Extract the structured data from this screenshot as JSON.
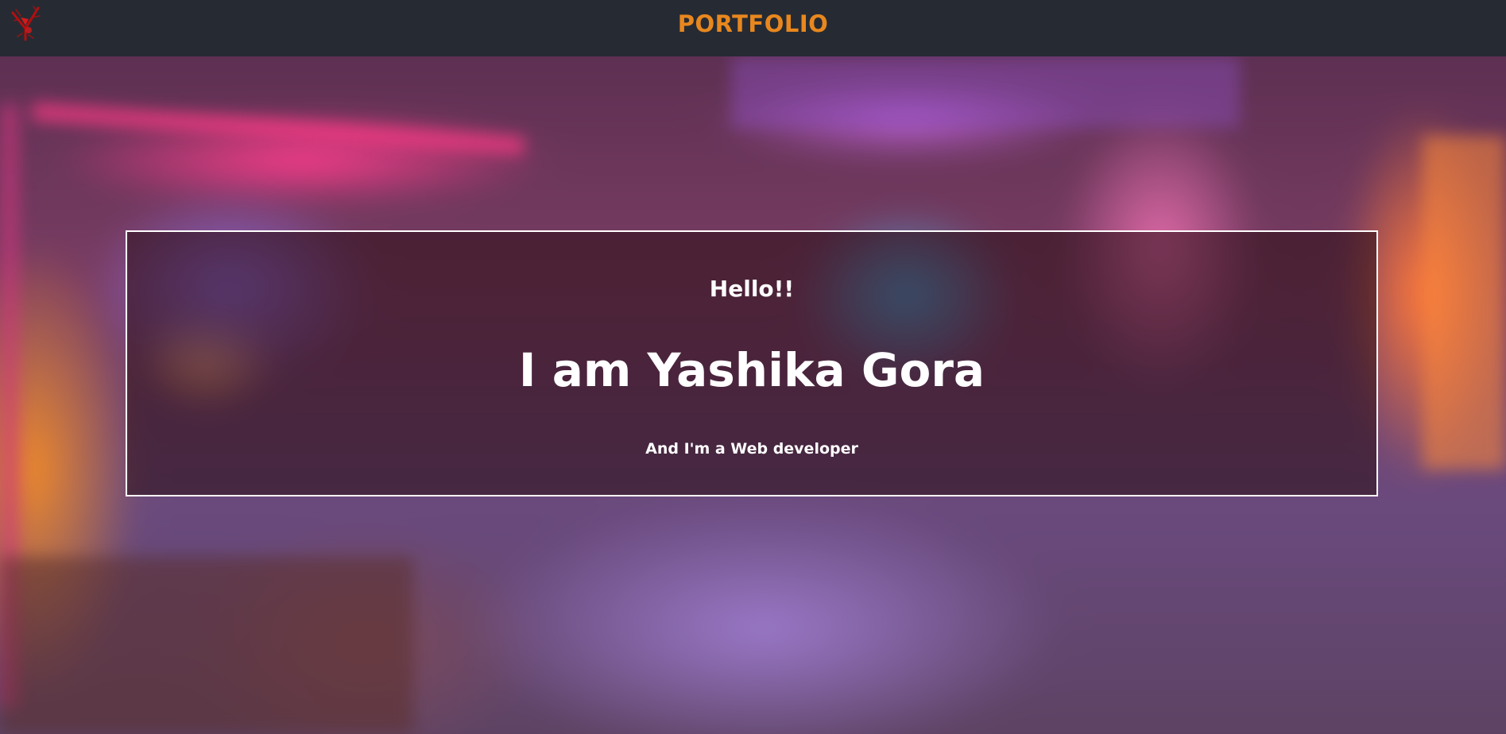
{
  "navbar": {
    "logo_icon": "y-monogram-logo-icon",
    "logo_color": "#cc1111",
    "title": "PORTFOLIO",
    "title_color": "#e8871e",
    "background": "#262b33"
  },
  "hero": {
    "greeting": "Hello!!",
    "name": "I am Yashika Gora",
    "role": "And I'm a Web developer",
    "border_color": "#ffffff",
    "text_color": "#ffffff"
  }
}
